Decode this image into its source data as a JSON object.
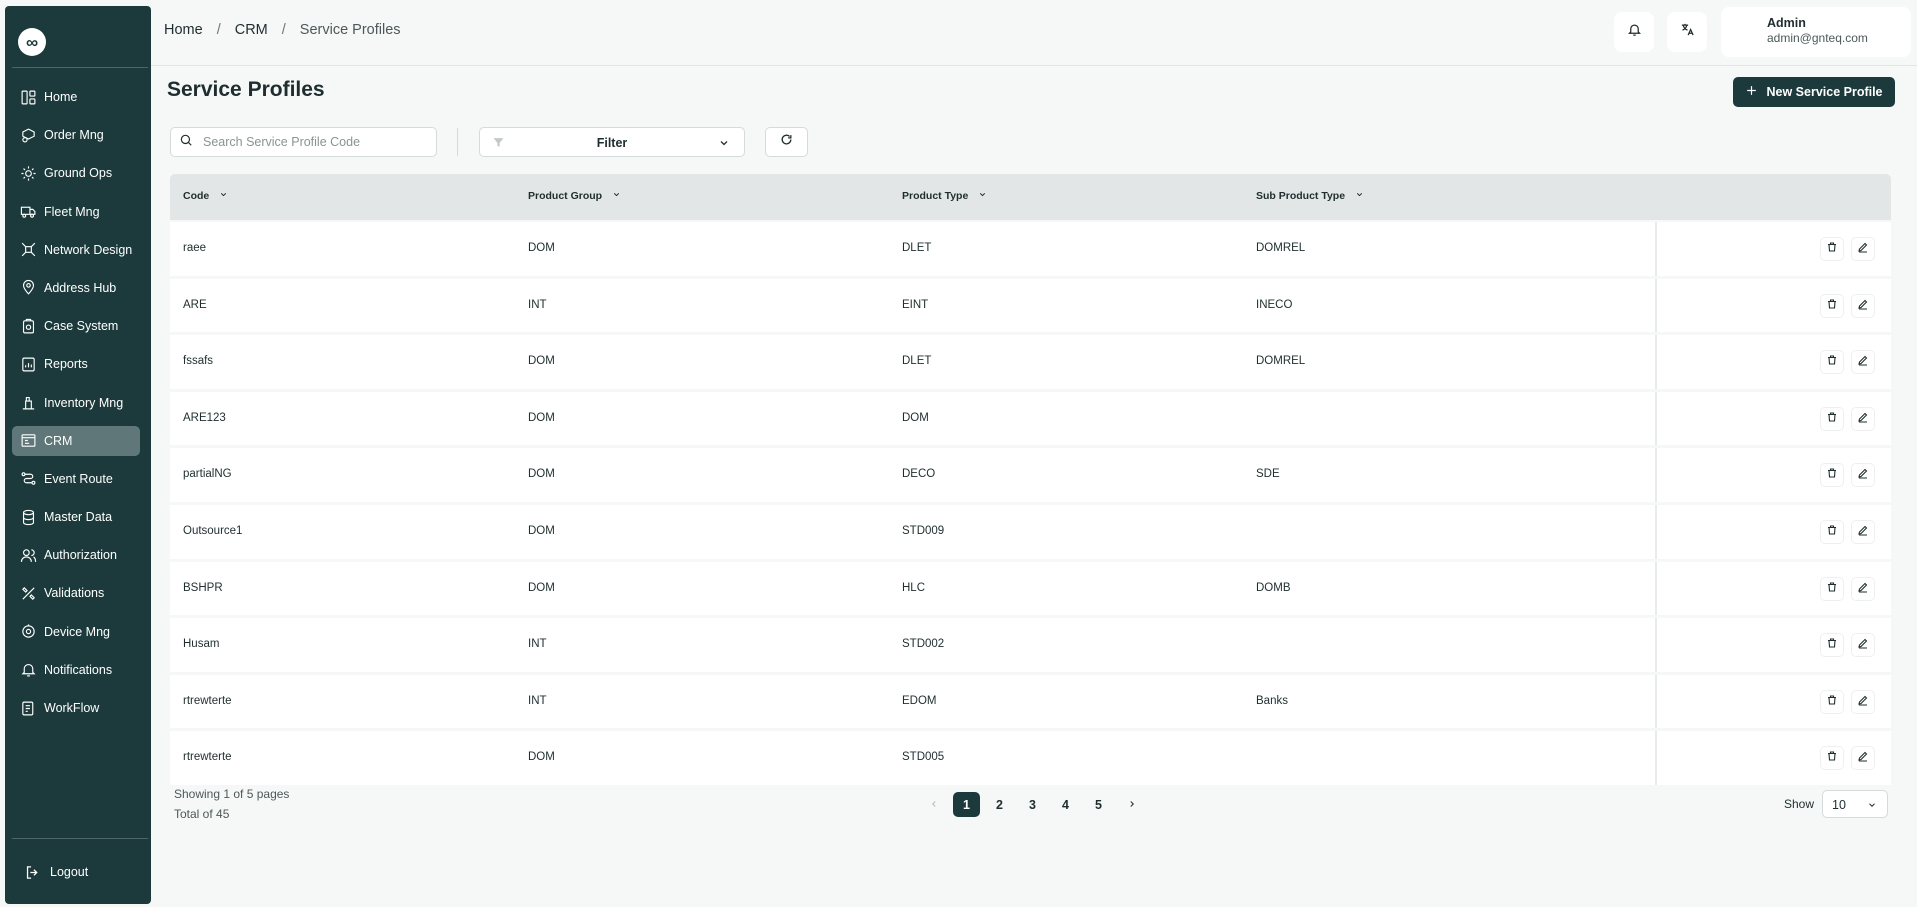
{
  "sidebar": {
    "logo": "∞",
    "items": [
      {
        "label": "Home",
        "icon": "layout-icon"
      },
      {
        "label": "Order Mng",
        "icon": "order-box-icon"
      },
      {
        "label": "Ground Ops",
        "icon": "ground-ops-icon"
      },
      {
        "label": "Fleet Mng",
        "icon": "truck-icon"
      },
      {
        "label": "Network Design",
        "icon": "network-icon"
      },
      {
        "label": "Address Hub",
        "icon": "location-pin-icon"
      },
      {
        "label": "Case System",
        "icon": "case-icon"
      },
      {
        "label": "Reports",
        "icon": "report-icon"
      },
      {
        "label": "Inventory Mng",
        "icon": "inventory-icon"
      },
      {
        "label": "CRM",
        "icon": "crm-icon",
        "active": true
      },
      {
        "label": "Event Route",
        "icon": "route-icon"
      },
      {
        "label": "Master Data",
        "icon": "database-icon"
      },
      {
        "label": "Authorization",
        "icon": "users-icon"
      },
      {
        "label": "Validations",
        "icon": "validation-icon"
      },
      {
        "label": "Device Mng",
        "icon": "device-icon"
      },
      {
        "label": "Notifications",
        "icon": "bell-icon"
      },
      {
        "label": "WorkFlow",
        "icon": "workflow-icon"
      }
    ],
    "logout_label": "Logout"
  },
  "header": {
    "breadcrumb": {
      "home": "Home",
      "crm": "CRM",
      "current": "Service Profiles",
      "separator": "/"
    },
    "user": {
      "name": "Admin",
      "email": "admin@gnteq.com"
    }
  },
  "main": {
    "title": "Service Profiles",
    "new_button_label": "New Service Profile",
    "search_placeholder": "Search Service Profile Code",
    "filter_label": "Filter"
  },
  "table": {
    "columns": [
      "Code",
      "Product Group",
      "Product Type",
      "Sub Product Type"
    ],
    "rows": [
      {
        "code": "raee",
        "group": "DOM",
        "type": "DLET",
        "sub": "DOMREL"
      },
      {
        "code": "ARE",
        "group": "INT",
        "type": "EINT",
        "sub": "INECO"
      },
      {
        "code": "fssafs",
        "group": "DOM",
        "type": "DLET",
        "sub": "DOMREL"
      },
      {
        "code": "ARE123",
        "group": "DOM",
        "type": "DOM",
        "sub": ""
      },
      {
        "code": "partialNG",
        "group": "DOM",
        "type": "DECO",
        "sub": "SDE"
      },
      {
        "code": "Outsource1",
        "group": "DOM",
        "type": "STD009",
        "sub": ""
      },
      {
        "code": "BSHPR",
        "group": "DOM",
        "type": "HLC",
        "sub": "DOMB"
      },
      {
        "code": "Husam",
        "group": "INT",
        "type": "STD002",
        "sub": ""
      },
      {
        "code": "rtrewterte",
        "group": "INT",
        "type": "EDOM",
        "sub": "Banks"
      },
      {
        "code": "rtrewterte",
        "group": "DOM",
        "type": "STD005",
        "sub": ""
      }
    ]
  },
  "pagination": {
    "showing": "Showing 1 of 5 pages",
    "total": "Total of 45",
    "pages": [
      "1",
      "2",
      "3",
      "4",
      "5"
    ],
    "current": "1",
    "show_label": "Show",
    "page_size": "10"
  }
}
